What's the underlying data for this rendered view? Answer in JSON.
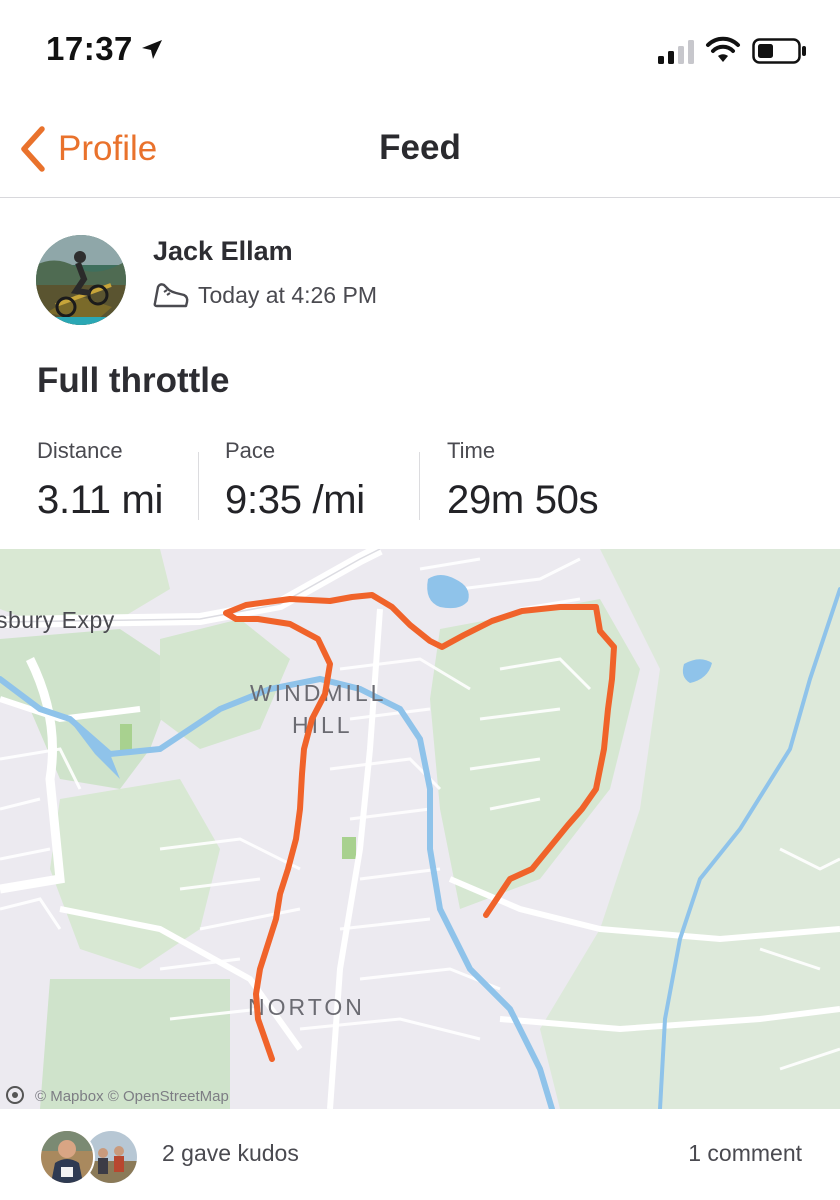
{
  "status_bar": {
    "time": "17:37"
  },
  "nav": {
    "back_label": "Profile",
    "title": "Feed"
  },
  "post": {
    "athlete_name": "Jack Ellam",
    "activity_icon": "shoe-icon",
    "timestamp": "Today at 4:26 PM",
    "title": "Full throttle",
    "stats": [
      {
        "label": "Distance",
        "value": "3.11 mi"
      },
      {
        "label": "Pace",
        "value": "9:35 /mi"
      },
      {
        "label": "Time",
        "value": "29m 50s"
      }
    ]
  },
  "map": {
    "labels": {
      "road": "sbury Expy",
      "place1": "WINDMILL",
      "place1b": "HILL",
      "place2": "NORTON"
    },
    "attribution": "© Mapbox © OpenStreetMap"
  },
  "footer": {
    "kudos": "2 gave kudos",
    "comments": "1 comment"
  },
  "colors": {
    "accent": "#fc5200",
    "route": "#f0632a",
    "water": "#8fc3ea",
    "park": "#cfe3cb"
  }
}
